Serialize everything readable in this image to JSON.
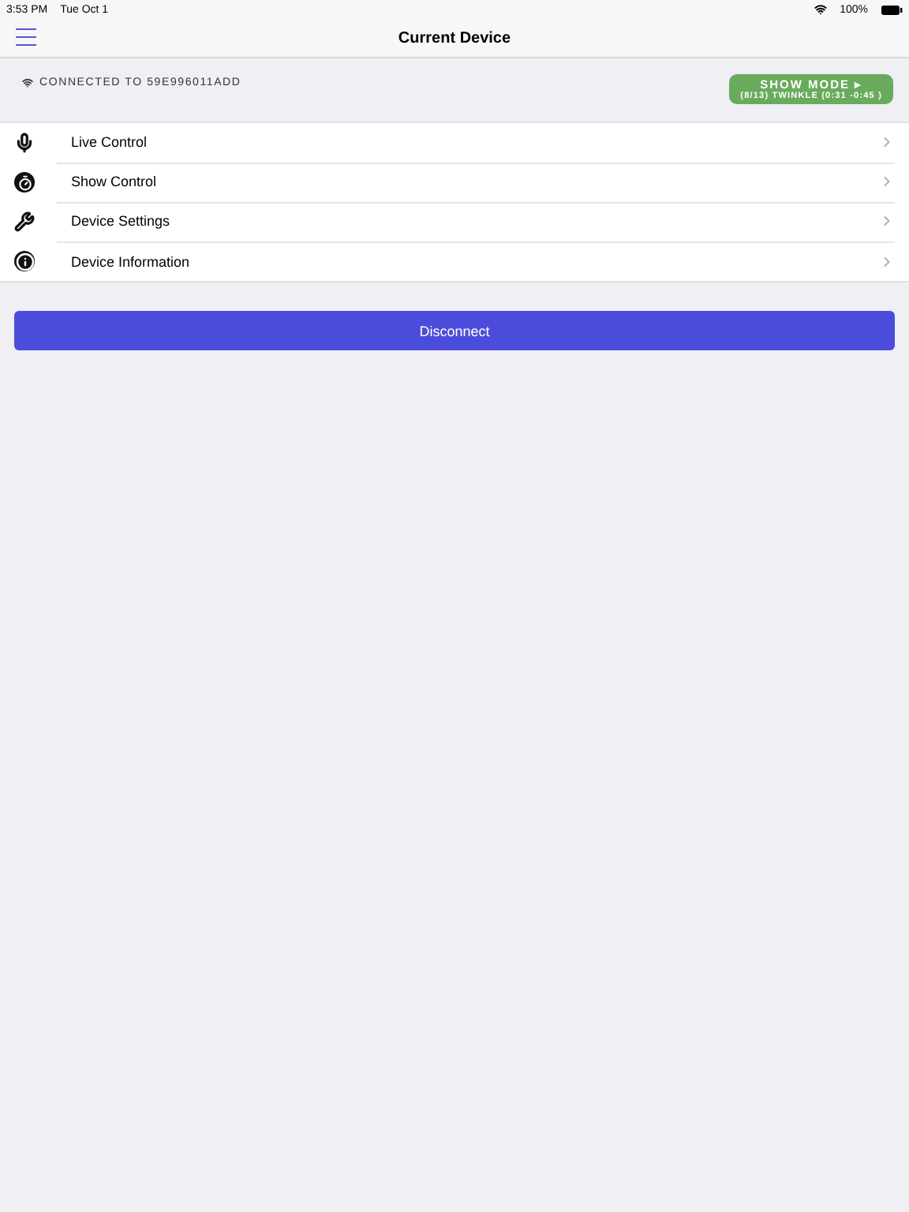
{
  "status_bar": {
    "time": "3:53 PM",
    "date": "Tue Oct 1",
    "battery": "100%"
  },
  "nav": {
    "title": "Current Device"
  },
  "connection": {
    "label": "CONNECTED TO 59E996011ADD"
  },
  "show_mode": {
    "title": "SHOW MODE ▸",
    "detail": "(8/13) TWINKLE (0:31 -0:45 )"
  },
  "menu": [
    {
      "kind": "mic",
      "label": "Live Control"
    },
    {
      "kind": "timer",
      "label": "Show Control"
    },
    {
      "kind": "tools",
      "label": "Device Settings"
    },
    {
      "kind": "info",
      "label": "Device Information"
    }
  ],
  "disconnect": {
    "label": "Disconnect"
  }
}
